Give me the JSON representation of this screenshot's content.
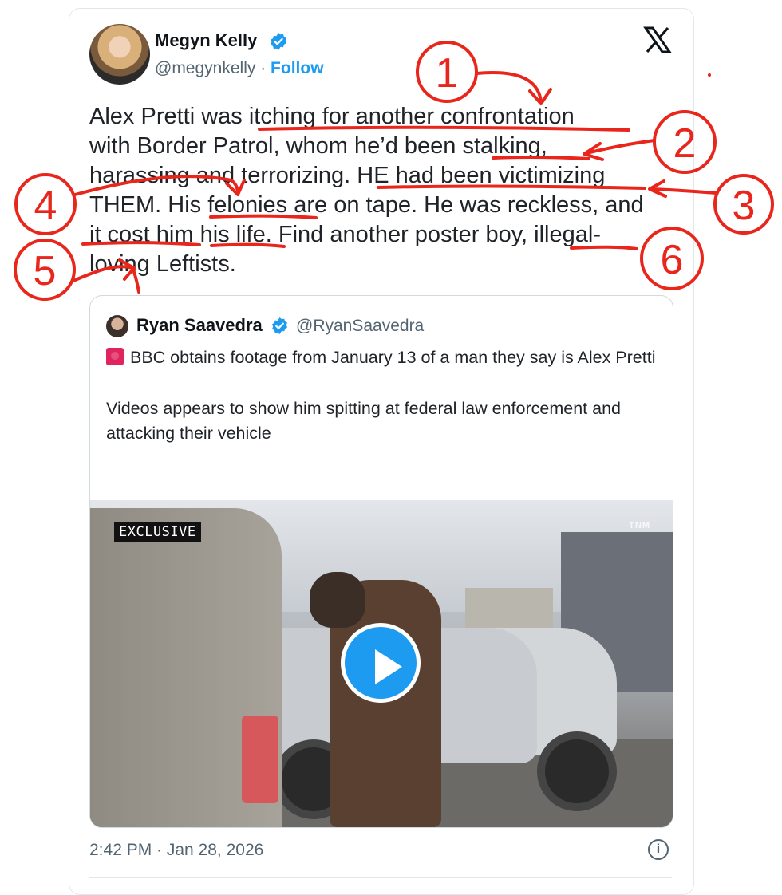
{
  "tweet": {
    "author_name": "Megyn Kelly",
    "author_handle": "@megynkelly",
    "separator": "·",
    "follow_label": "Follow",
    "body_lines": [
      "Alex Pretti was itching for another confrontation",
      "with Border Patrol, whom he’d been stalking,",
      "harassing and terrorizing. HE had been victimizing",
      "THEM. His felonies are on tape. He was reckless, and",
      "it cost him his life. Find another poster boy, illegal-",
      "loving Leftists."
    ],
    "timestamp": "2:42 PM · Jan 28, 2026"
  },
  "quote": {
    "author_name": "Ryan Saavedra",
    "author_handle": "@RyanSaavedra",
    "text_line1": "BBC obtains footage from January 13 of a man they say is Alex Pretti",
    "text_line2": "Videos appears to show him spitting at federal law enforcement and attacking their vehicle",
    "media_badge": "EXCLUSIVE",
    "watermark": "TNM"
  },
  "annotations": {
    "numbers": [
      "1",
      "2",
      "3",
      "4",
      "5",
      "6"
    ]
  },
  "colors": {
    "accent": "#1d9bf0",
    "annotation_red": "#e8261c",
    "text": "#0f1419",
    "muted": "#536471"
  },
  "icons": [
    "verified-badge-icon",
    "x-logo-icon",
    "siren-emoji-icon",
    "play-icon",
    "info-icon"
  ]
}
